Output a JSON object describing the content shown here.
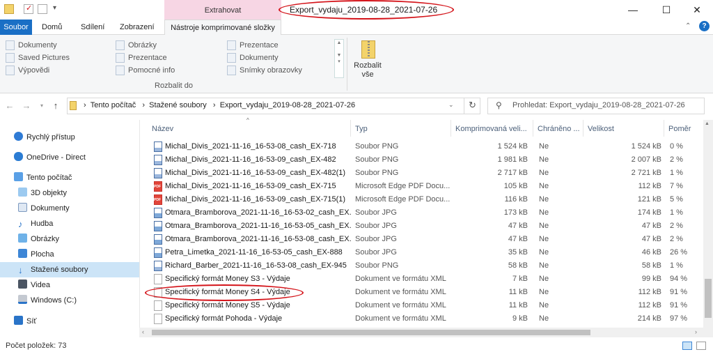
{
  "title_bar": {
    "contextual_tab": "Extrahovat",
    "window_title": "Export_vydaju_2019-08-28_2021-07-26",
    "minimize": "—",
    "maximize": "☐",
    "close": "✕"
  },
  "ribbon_tabs": [
    "Soubor",
    "Domů",
    "Sdílení",
    "Zobrazení",
    "Nástroje komprimované složky"
  ],
  "ribbon": {
    "col1": [
      "Dokumenty",
      "Saved Pictures",
      "Výpovědi"
    ],
    "col2": [
      "Obrázky",
      "Prezentace",
      "Pomocné info"
    ],
    "col3": [
      "Prezentace",
      "Dokumenty",
      "Snímky obrazovky"
    ],
    "group_label": "Rozbalit do",
    "extract_all": "Rozbalit vše"
  },
  "address": {
    "path": [
      "Tento počítač",
      "Stažené soubory",
      "Export_vydaju_2019-08-28_2021-07-26"
    ],
    "search_placeholder": "Prohledat: Export_vydaju_2019-08-28_2021-07-26"
  },
  "nav_pane": {
    "quick_access": "Rychlý přístup",
    "onedrive": "OneDrive - Direct",
    "this_pc": "Tento počítač",
    "items": [
      "3D objekty",
      "Dokumenty",
      "Hudba",
      "Obrázky",
      "Plocha",
      "Stažené soubory",
      "Videa",
      "Windows (C:)"
    ],
    "network": "Síť"
  },
  "columns": [
    "Název",
    "Typ",
    "Komprimovaná veli...",
    "Chráněno ...",
    "Velikost",
    "Poměr"
  ],
  "files": [
    {
      "name": "Michal_Divis_2021-11-16_16-53-08_cash_EX-718",
      "type": "Soubor PNG",
      "comp": "1 524 kB",
      "prot": "Ne",
      "size": "1 524 kB",
      "ratio": "0 %",
      "icon": "png"
    },
    {
      "name": "Michal_Divis_2021-11-16_16-53-09_cash_EX-482",
      "type": "Soubor PNG",
      "comp": "1 981 kB",
      "prot": "Ne",
      "size": "2 007 kB",
      "ratio": "2 %",
      "icon": "png"
    },
    {
      "name": "Michal_Divis_2021-11-16_16-53-09_cash_EX-482(1)",
      "type": "Soubor PNG",
      "comp": "2 717 kB",
      "prot": "Ne",
      "size": "2 721 kB",
      "ratio": "1 %",
      "icon": "png"
    },
    {
      "name": "Michal_Divis_2021-11-16_16-53-09_cash_EX-715",
      "type": "Microsoft Edge PDF Docu...",
      "comp": "105 kB",
      "prot": "Ne",
      "size": "112 kB",
      "ratio": "7 %",
      "icon": "pdf"
    },
    {
      "name": "Michal_Divis_2021-11-16_16-53-09_cash_EX-715(1)",
      "type": "Microsoft Edge PDF Docu...",
      "comp": "116 kB",
      "prot": "Ne",
      "size": "121 kB",
      "ratio": "5 %",
      "icon": "pdf"
    },
    {
      "name": "Otmara_Bramborova_2021-11-16_16-53-02_cash_EX...",
      "type": "Soubor JPG",
      "comp": "173 kB",
      "prot": "Ne",
      "size": "174 kB",
      "ratio": "1 %",
      "icon": "jpg"
    },
    {
      "name": "Otmara_Bramborova_2021-11-16_16-53-05_cash_EX...",
      "type": "Soubor JPG",
      "comp": "47 kB",
      "prot": "Ne",
      "size": "47 kB",
      "ratio": "2 %",
      "icon": "jpg"
    },
    {
      "name": "Otmara_Bramborova_2021-11-16_16-53-08_cash_EX...",
      "type": "Soubor JPG",
      "comp": "47 kB",
      "prot": "Ne",
      "size": "47 kB",
      "ratio": "2 %",
      "icon": "jpg"
    },
    {
      "name": "Petra_Limetka_2021-11-16_16-53-05_cash_EX-888",
      "type": "Soubor JPG",
      "comp": "35 kB",
      "prot": "Ne",
      "size": "46 kB",
      "ratio": "26 %",
      "icon": "jpg"
    },
    {
      "name": "Richard_Barber_2021-11-16_16-53-08_cash_EX-945",
      "type": "Soubor PNG",
      "comp": "58 kB",
      "prot": "Ne",
      "size": "58 kB",
      "ratio": "1 %",
      "icon": "png"
    },
    {
      "name": "Specifický formát Money S3 - Výdaje",
      "type": "Dokument ve formátu XML",
      "comp": "7 kB",
      "prot": "Ne",
      "size": "99 kB",
      "ratio": "94 %",
      "icon": "xml"
    },
    {
      "name": "Specifický formát Money S4 - Výdaje",
      "type": "Dokument ve formátu XML",
      "comp": "11 kB",
      "prot": "Ne",
      "size": "112 kB",
      "ratio": "91 %",
      "icon": "xml"
    },
    {
      "name": "Specifický formát Money S5 - Výdaje",
      "type": "Dokument ve formátu XML",
      "comp": "11 kB",
      "prot": "Ne",
      "size": "112 kB",
      "ratio": "91 %",
      "icon": "xml"
    },
    {
      "name": "Specifický formát Pohoda - Výdaje",
      "type": "Dokument ve formátu XML",
      "comp": "9 kB",
      "prot": "Ne",
      "size": "214 kB",
      "ratio": "97 %",
      "icon": "xml"
    }
  ],
  "status": "Počet položek: 73",
  "colors": {
    "file_tab": "#1a6fc5",
    "context_tab": "#f7d6e4",
    "selected": "#cce4f7",
    "annotation": "#d4141a"
  },
  "icons": [
    "folder-icon",
    "undo-icon",
    "back-icon",
    "forward-icon",
    "up-icon",
    "refresh-icon",
    "search-icon",
    "help-icon",
    "zip-folder-icon"
  ]
}
